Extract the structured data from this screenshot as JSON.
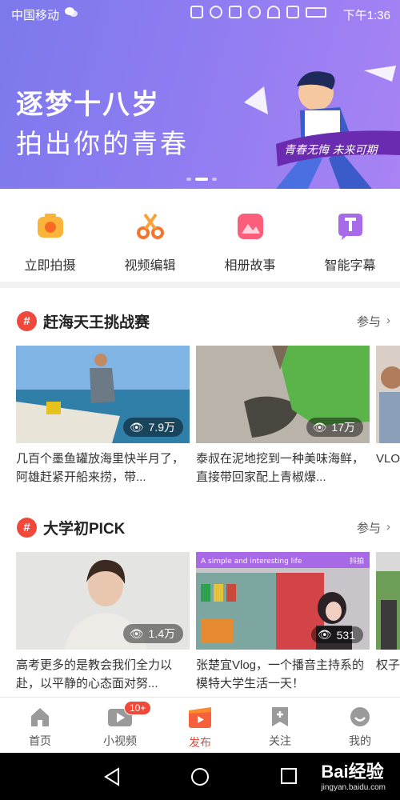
{
  "status": {
    "carrier": "中国移动",
    "time": "下午1:36"
  },
  "banner": {
    "line1": "逐梦十八岁",
    "line2": "拍出你的青春",
    "ribbon_text": "青春无悔  未来可期"
  },
  "actions": [
    {
      "label": "立即拍摄",
      "icon": "camera-icon"
    },
    {
      "label": "视频编辑",
      "icon": "scissors-icon"
    },
    {
      "label": "相册故事",
      "icon": "album-icon"
    },
    {
      "label": "智能字幕",
      "icon": "subtitle-icon"
    }
  ],
  "sections": [
    {
      "title": "赶海天王挑战赛",
      "join": "参与",
      "cards": [
        {
          "views": "7.9万",
          "caption": "几百个墨鱼罐放海里快半月了，阿雄赶紧开船来捞，带..."
        },
        {
          "views": "17万",
          "caption": "泰叔在泥地挖到一种美味海鲜，直接带回家配上青椒爆..."
        },
        {
          "views": "",
          "caption": "VLO小伙"
        }
      ]
    },
    {
      "title": "大学初PICK",
      "join": "参与",
      "cards": [
        {
          "views": "1.4万",
          "caption": "高考更多的是教会我们全力以赴，以平静的心态面对努..."
        },
        {
          "views": "531",
          "caption": "张楚宜Vlog，一个播音主持系的模特大学生活一天！",
          "overlay_left": "A simple and interesting life",
          "overlay_right": "抖拍"
        },
        {
          "views": "",
          "caption": "权子彩，"
        }
      ]
    }
  ],
  "nav": {
    "tabs": [
      {
        "label": "首页",
        "icon": "home-icon"
      },
      {
        "label": "小视频",
        "icon": "video-icon",
        "badge": "10+"
      },
      {
        "label": "发布",
        "icon": "publish-icon"
      },
      {
        "label": "关注",
        "icon": "bookmark-icon"
      },
      {
        "label": "我的",
        "icon": "profile-icon"
      }
    ],
    "active": "发布"
  },
  "watermark": {
    "brand": "Bai经验",
    "url": "jingyan.baidu.com"
  },
  "colors": {
    "accent": "#f0493b",
    "banner": "#8e7cf1",
    "orange": "#fb8a2e"
  }
}
